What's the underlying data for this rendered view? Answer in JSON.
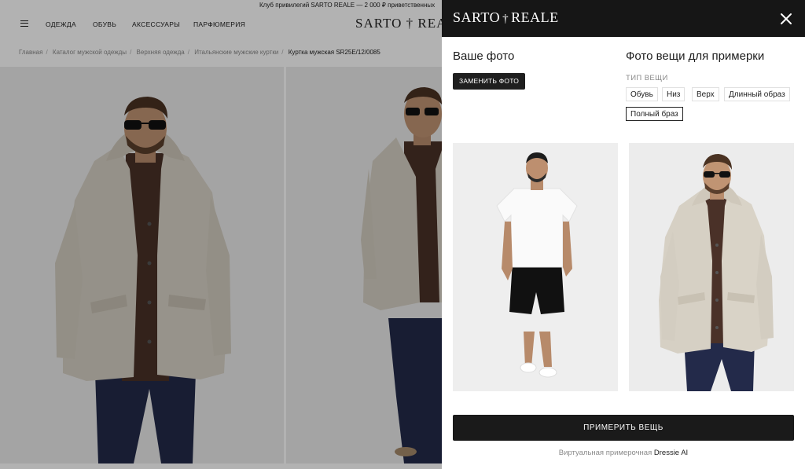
{
  "promo_text": "Клуб привилегий SARTO REALE — 2 000 ₽ приветственных",
  "nav": {
    "items": [
      "ОДЕЖДА",
      "ОБУВЬ",
      "АКСЕССУАРЫ",
      "ПАРФЮМЕРИЯ"
    ],
    "logo": "SARTO † REALE"
  },
  "breadcrumb": {
    "items": [
      "Главная",
      "Каталог мужской одежды",
      "Верхняя одежда",
      "Итальянские мужские куртки"
    ],
    "separator": "/",
    "current": "Куртка мужская SR25E/12/0085"
  },
  "drawer": {
    "logo_left": "SARTO",
    "logo_sep": "†",
    "logo_right": "REALE",
    "your_photo_title": "Ваше фото",
    "replace_button": "ЗАМЕНИТЬ ФОТО",
    "item_photo_title": "Фото вещи для примерки",
    "type_label": "ТИП ВЕЩИ",
    "types": [
      "Обувь",
      "Низ",
      "Верх",
      "Длинный образ",
      "Полный браз"
    ],
    "active_type": "Полный браз",
    "try_button": "ПРИМЕРИТЬ ВЕЩЬ",
    "footer_prefix": "Виртуальная примерочная",
    "footer_brand": "Dressie AI"
  },
  "colors": {
    "header_bg": "#161616",
    "button_bg": "#1a1a1a",
    "coat": "#d8d2c6",
    "trousers": "#232a4a"
  }
}
